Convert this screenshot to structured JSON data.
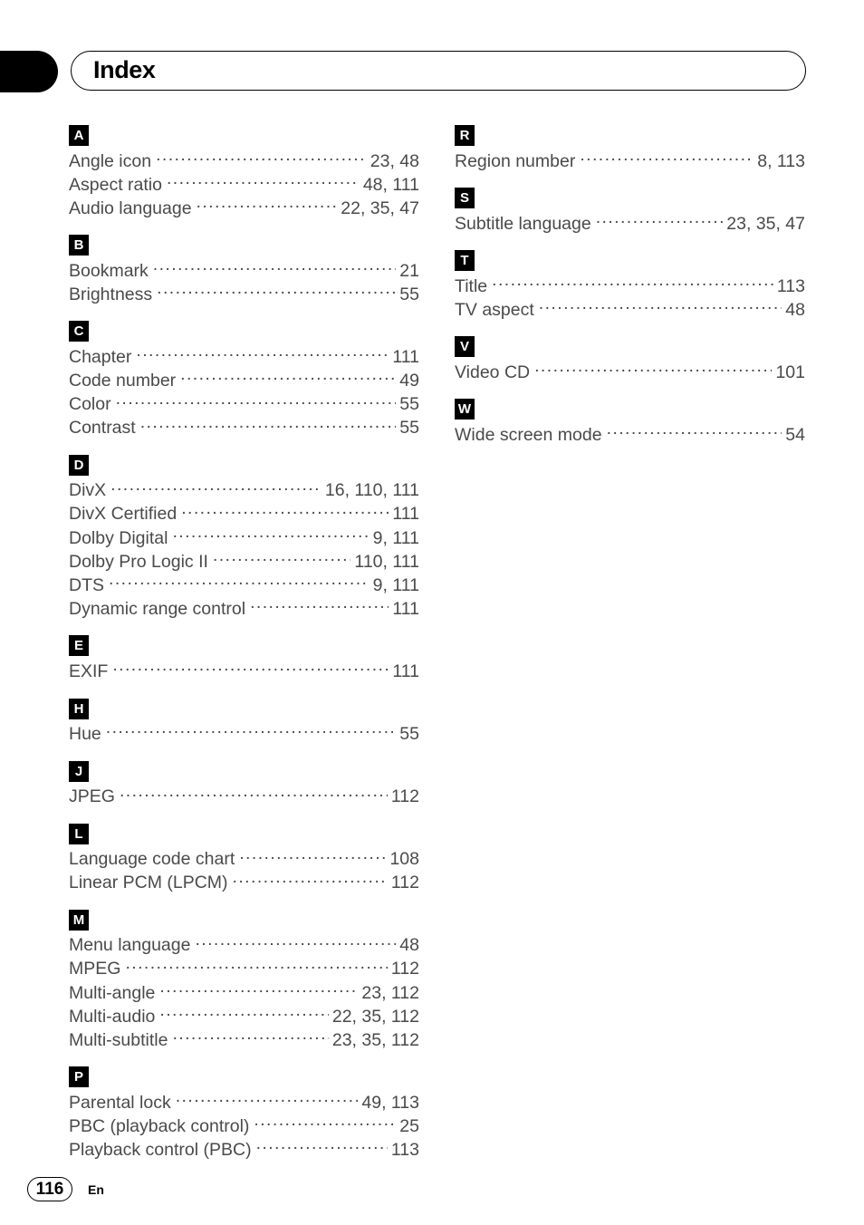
{
  "header": {
    "title": "Index"
  },
  "footer": {
    "page_number": "116",
    "language": "En"
  },
  "columns": [
    {
      "name": "left",
      "sections": [
        {
          "letter": "A",
          "entries": [
            {
              "label": "Angle icon",
              "pages": "23, 48"
            },
            {
              "label": "Aspect ratio",
              "pages": "48, 111"
            },
            {
              "label": "Audio language",
              "pages": "22, 35, 47"
            }
          ]
        },
        {
          "letter": "B",
          "entries": [
            {
              "label": "Bookmark",
              "pages": "21"
            },
            {
              "label": "Brightness",
              "pages": "55"
            }
          ]
        },
        {
          "letter": "C",
          "entries": [
            {
              "label": "Chapter",
              "pages": "111"
            },
            {
              "label": "Code number",
              "pages": "49"
            },
            {
              "label": "Color",
              "pages": "55"
            },
            {
              "label": "Contrast",
              "pages": "55"
            }
          ]
        },
        {
          "letter": "D",
          "entries": [
            {
              "label": "DivX",
              "pages": "16, 110, 111"
            },
            {
              "label": "DivX Certified",
              "pages": "111"
            },
            {
              "label": "Dolby Digital",
              "pages": "9, 111"
            },
            {
              "label": "Dolby Pro Logic II",
              "pages": "110, 111"
            },
            {
              "label": "DTS",
              "pages": "9, 111"
            },
            {
              "label": "Dynamic range control",
              "pages": "111"
            }
          ]
        },
        {
          "letter": "E",
          "entries": [
            {
              "label": "EXIF",
              "pages": "111"
            }
          ]
        },
        {
          "letter": "H",
          "entries": [
            {
              "label": "Hue",
              "pages": "55"
            }
          ]
        },
        {
          "letter": "J",
          "entries": [
            {
              "label": "JPEG",
              "pages": "112"
            }
          ]
        },
        {
          "letter": "L",
          "entries": [
            {
              "label": "Language code chart",
              "pages": "108"
            },
            {
              "label": "Linear PCM (LPCM)",
              "pages": "112"
            }
          ]
        },
        {
          "letter": "M",
          "entries": [
            {
              "label": "Menu language",
              "pages": "48"
            },
            {
              "label": "MPEG",
              "pages": "112"
            },
            {
              "label": "Multi-angle",
              "pages": "23, 112"
            },
            {
              "label": "Multi-audio",
              "pages": "22, 35, 112"
            },
            {
              "label": "Multi-subtitle",
              "pages": "23, 35, 112"
            }
          ]
        },
        {
          "letter": "P",
          "entries": [
            {
              "label": "Parental lock",
              "pages": "49, 113"
            },
            {
              "label": "PBC (playback control)",
              "pages": "25"
            },
            {
              "label": "Playback control (PBC)",
              "pages": "113"
            }
          ]
        }
      ]
    },
    {
      "name": "right",
      "sections": [
        {
          "letter": "R",
          "entries": [
            {
              "label": "Region number",
              "pages": "8, 113"
            }
          ]
        },
        {
          "letter": "S",
          "entries": [
            {
              "label": "Subtitle language",
              "pages": "23, 35, 47"
            }
          ]
        },
        {
          "letter": "T",
          "entries": [
            {
              "label": "Title",
              "pages": "113"
            },
            {
              "label": "TV aspect",
              "pages": "48"
            }
          ]
        },
        {
          "letter": "V",
          "entries": [
            {
              "label": "Video CD",
              "pages": "101"
            }
          ]
        },
        {
          "letter": "W",
          "entries": [
            {
              "label": "Wide screen mode",
              "pages": "54"
            }
          ]
        }
      ]
    }
  ]
}
